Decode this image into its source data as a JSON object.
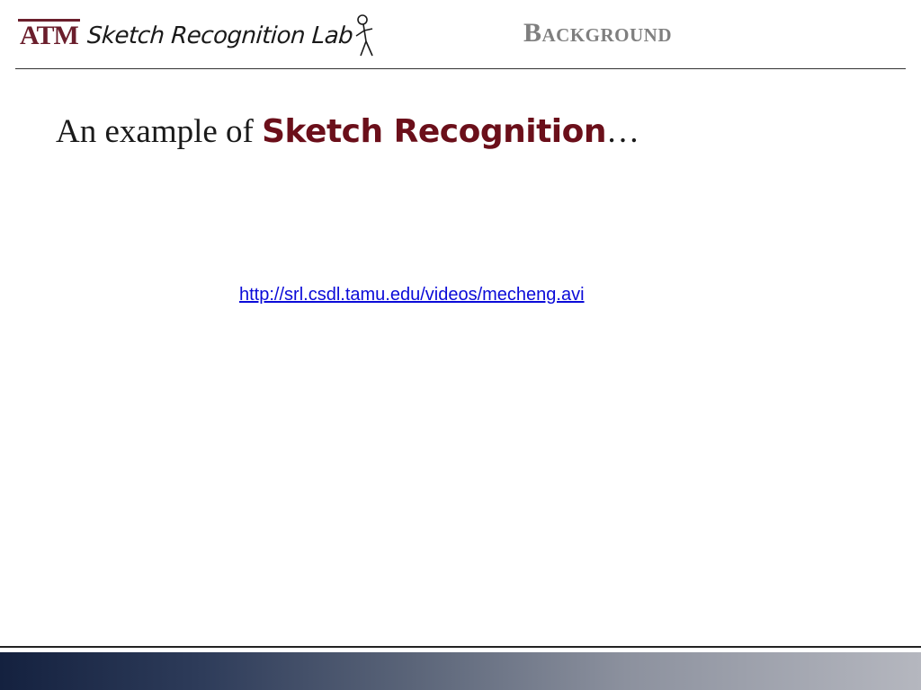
{
  "header": {
    "logo_monogram": "ATM",
    "logo_text": "Sketch Recognition Lab",
    "section_title": "Background"
  },
  "slide": {
    "title_lead": "An example of ",
    "title_emphasis": "Sketch Recognition",
    "title_tail": "…",
    "video_link": "http://srl.csdl.tamu.edu/videos/mecheng.avi"
  },
  "colors": {
    "brand_maroon": "#6b1e2c",
    "title_emphasis": "#6b0f1a",
    "section_title_gray": "#7f7f7f",
    "link_blue": "#0b0bd8"
  }
}
